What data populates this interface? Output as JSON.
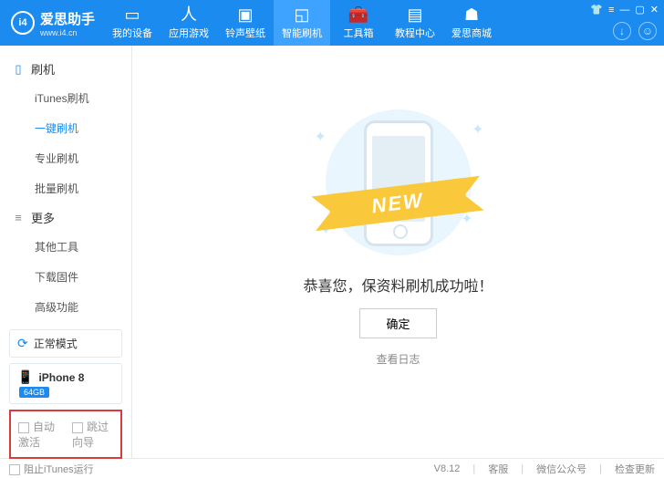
{
  "header": {
    "brand": "爱思助手",
    "brand_badge": "i4",
    "brand_url": "www.i4.cn",
    "tabs": [
      {
        "label": "我的设备"
      },
      {
        "label": "应用游戏"
      },
      {
        "label": "铃声壁纸"
      },
      {
        "label": "智能刷机",
        "active": true
      },
      {
        "label": "工具箱"
      },
      {
        "label": "教程中心"
      },
      {
        "label": "爱思商城"
      }
    ]
  },
  "sidebar": {
    "cat1": "刷机",
    "items1": [
      "iTunes刷机",
      "一键刷机",
      "专业刷机",
      "批量刷机"
    ],
    "active1": 1,
    "cat2": "更多",
    "items2": [
      "其他工具",
      "下载固件",
      "高级功能"
    ],
    "mode": "正常模式",
    "device": {
      "name": "iPhone 8",
      "storage": "64GB"
    },
    "opts": {
      "auto_activate": "自动激活",
      "skip_guide": "跳过向导"
    }
  },
  "content": {
    "ribbon": "NEW",
    "message": "恭喜您，保资料刷机成功啦！",
    "ok": "确定",
    "view_log": "查看日志"
  },
  "footer": {
    "block_itunes": "阻止iTunes运行",
    "version": "V8.12",
    "support": "客服",
    "wechat": "微信公众号",
    "update": "检查更新"
  }
}
